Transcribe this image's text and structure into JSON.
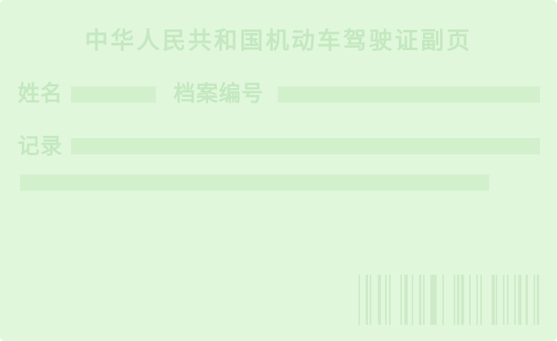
{
  "card": {
    "title": "中华人民共和国机动车驾驶证副页",
    "name_label": "姓名",
    "file_number_label": "档案编号",
    "record_label": "记录",
    "name_value": "",
    "file_number_value": "",
    "record_value": "",
    "record_continuation_value": ""
  },
  "colors": {
    "background": "#e0f7dc",
    "text": "#c4e8bf",
    "field": "#d2f0cc",
    "barcode": "#cdebc7"
  },
  "barcode": {
    "pattern": [
      1,
      0,
      1,
      1,
      0,
      2,
      0,
      1,
      1,
      0,
      0,
      1,
      2,
      0,
      1,
      0,
      1,
      1,
      0,
      2,
      1,
      0,
      1,
      0,
      0,
      1,
      1,
      2,
      0,
      1,
      0,
      1,
      1,
      0,
      0,
      2,
      1,
      0,
      1,
      1,
      0,
      1,
      2,
      0,
      1,
      0,
      1,
      1
    ]
  }
}
